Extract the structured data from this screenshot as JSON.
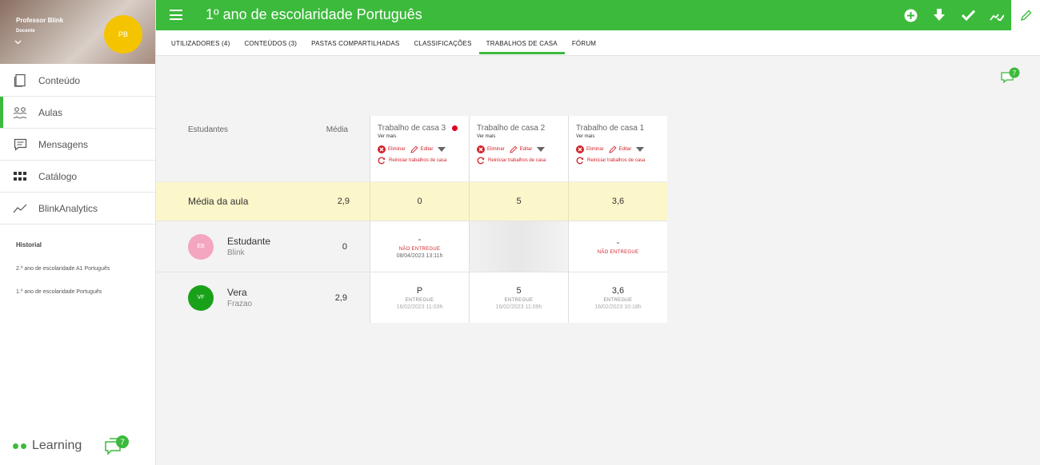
{
  "profile": {
    "name": "Professor Blink",
    "role": "Docente",
    "initials": "PB",
    "avatar_color": "#f5c400"
  },
  "sidebar": {
    "items": [
      {
        "label": "Conteúdo",
        "icon": "book-icon"
      },
      {
        "label": "Aulas",
        "icon": "people-icon"
      },
      {
        "label": "Mensagens",
        "icon": "message-icon"
      },
      {
        "label": "Catálogo",
        "icon": "grid-icon"
      },
      {
        "label": "BlinkAnalytics",
        "icon": "trend-icon"
      }
    ],
    "historial_title": "Historial",
    "historial_items": [
      "2.º ano de escolaridade A1 Português",
      "1.º ano de escolaridade  Português"
    ],
    "learning_label": "Learning",
    "chat_badge": "7"
  },
  "header": {
    "title": "1º ano de escolaridade Português",
    "accent": "#3cba3c"
  },
  "tabs": [
    "UTILIZADORES (4)",
    "CONTEÚDOS (3)",
    "PASTAS COMPARTILHADAS",
    "CLASSIFICAÇÕES",
    "TRABALHOS DE CASA",
    "FÓRUM"
  ],
  "chat_top_badge": "7",
  "table": {
    "col_students": "Estudantes",
    "col_avg": "Média",
    "homeworks": [
      {
        "title": "Trabalho de casa 3",
        "ver_mais": "Ver mais",
        "delete": "Eliminar",
        "edit": "Editar",
        "reset": "Reiniciar trabalhos de casa"
      },
      {
        "title": "Trabalho de casa 2",
        "ver_mais": "Ver mais",
        "delete": "Eliminar",
        "edit": "Editar",
        "reset": "Reiniciar trabalhos de casa"
      },
      {
        "title": "Trabalho de casa 1",
        "ver_mais": "Ver mais",
        "delete": "Eliminar",
        "edit": "Editar",
        "reset": "Reiniciar trabalhos de casa"
      }
    ],
    "class_avg": {
      "label": "Média da aula",
      "avg": "2,9",
      "values": [
        "0",
        "5",
        "3,6"
      ]
    },
    "students": [
      {
        "first": "Estudante",
        "last": "Blink",
        "initials": "EB",
        "avatar_color": "#f4a6c0",
        "avg": "0",
        "grades": [
          {
            "value": "-",
            "status": "NÃO ENTREGUE",
            "date": "08/04/2023 13:11h"
          },
          {
            "value": "",
            "status": "",
            "date": ""
          },
          {
            "value": "-",
            "status": "NÃO ENTREGUE",
            "date": ""
          }
        ]
      },
      {
        "first": "Vera",
        "last": "Frazao",
        "initials": "VF",
        "avatar_color": "#1aa11a",
        "avg": "2,9",
        "grades": [
          {
            "value": "P",
            "status": "ENTREGUE",
            "date": "16/02/2023 11:03h"
          },
          {
            "value": "5",
            "status": "ENTREGUE",
            "date": "16/02/2023 11:09h"
          },
          {
            "value": "3,6",
            "status": "ENTREGUE",
            "date": "16/02/2023 10:18h"
          }
        ]
      }
    ]
  }
}
